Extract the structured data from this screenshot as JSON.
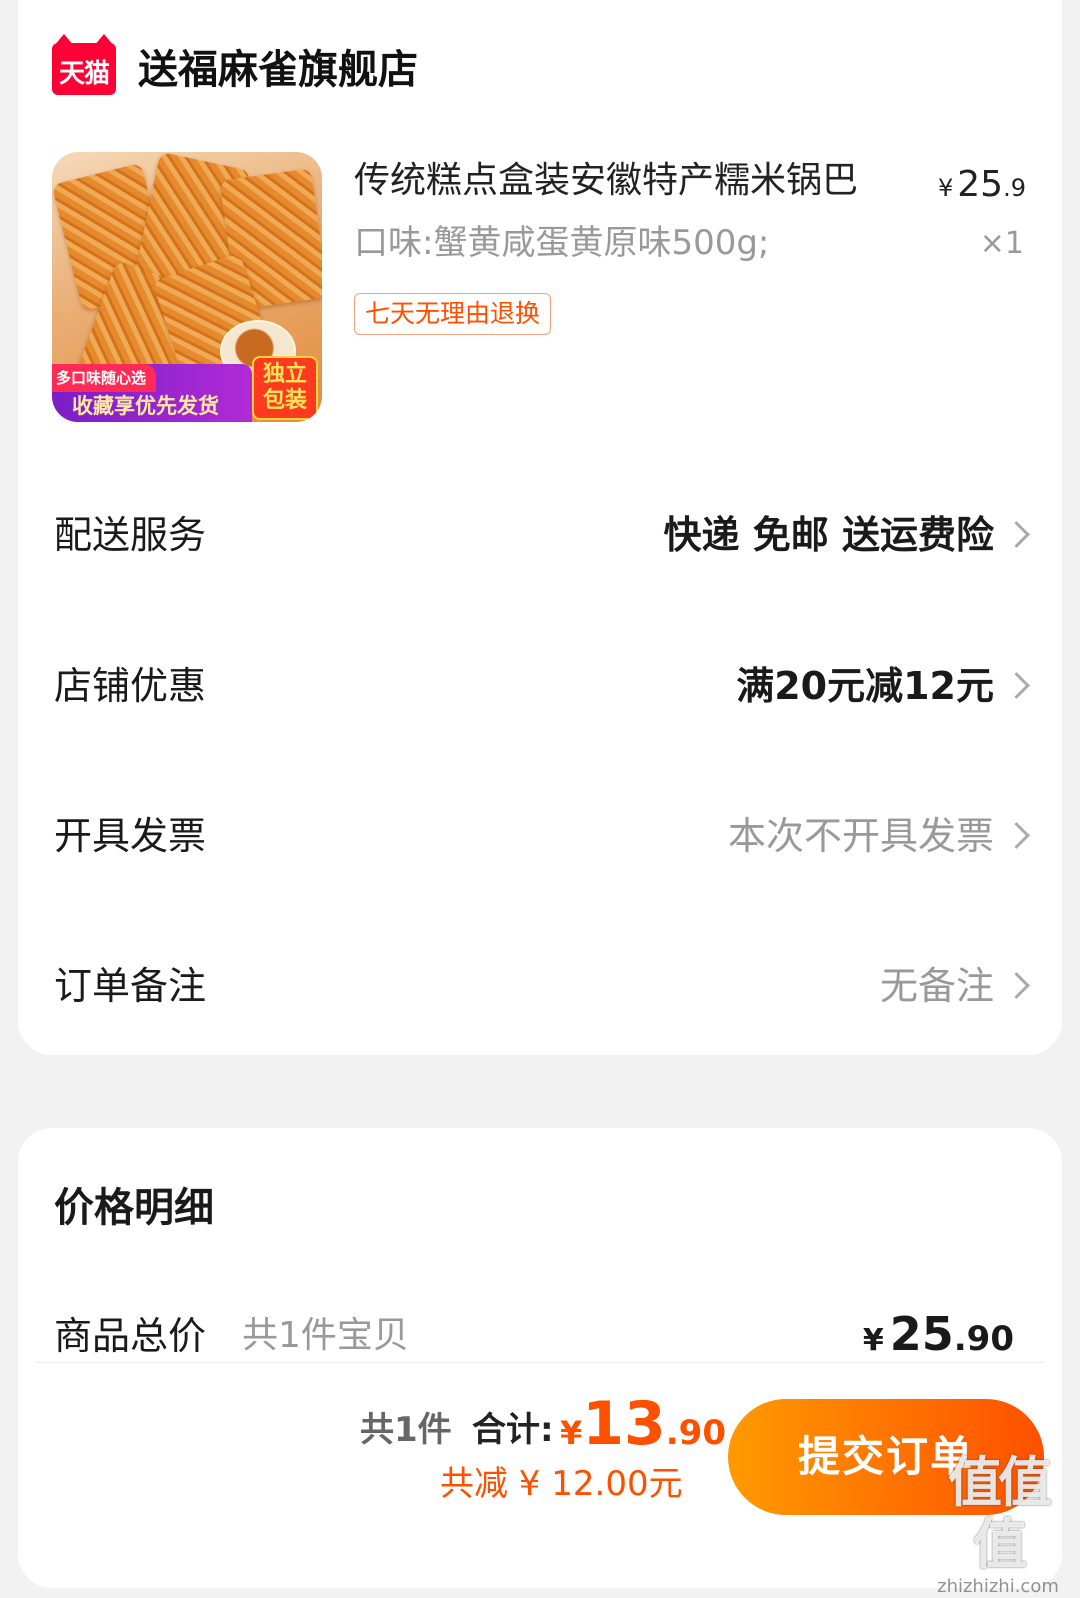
{
  "store": {
    "logo_text": "天猫",
    "name": "送福麻雀旗舰店"
  },
  "product": {
    "title": "传统糕点盒装安徽特产糯米锅巴",
    "price_currency": "¥",
    "price_int": "25",
    "price_dec": ".9",
    "spec": "口味:蟹黄咸蛋黄原味500g;",
    "quantity": "×1",
    "tag": "七天无理由退换",
    "thumb_band_top": "多口味随心选",
    "thumb_band_main": "收藏享优先发货",
    "thumb_badge_1": "独立",
    "thumb_badge_2": "包装"
  },
  "rows": [
    {
      "label": "配送服务",
      "value": "快递 免邮 送运费险"
    },
    {
      "label": "店铺优惠",
      "value": "满20元减12元"
    },
    {
      "label": "开具发票",
      "value": "本次不开具发票"
    },
    {
      "label": "订单备注",
      "value": "无备注"
    }
  ],
  "price_detail": {
    "heading": "价格明细",
    "total_label": "商品总价",
    "total_count": "共1件宝贝",
    "total_currency": "¥",
    "total_int": "25",
    "total_dec": ".90"
  },
  "bottom_bar": {
    "count": "共1件",
    "total_label": "合计:",
    "total_currency": "¥",
    "total_int": "13",
    "total_dec": ".90",
    "savings": "共减 ¥ 12.00元",
    "submit_label": "提交订单"
  },
  "watermark": {
    "big": "值值值",
    "small": "zhizhizhi.com"
  },
  "colors": {
    "accent": "#ff5000",
    "tmall_red": "#ff0036",
    "muted": "#999999"
  }
}
